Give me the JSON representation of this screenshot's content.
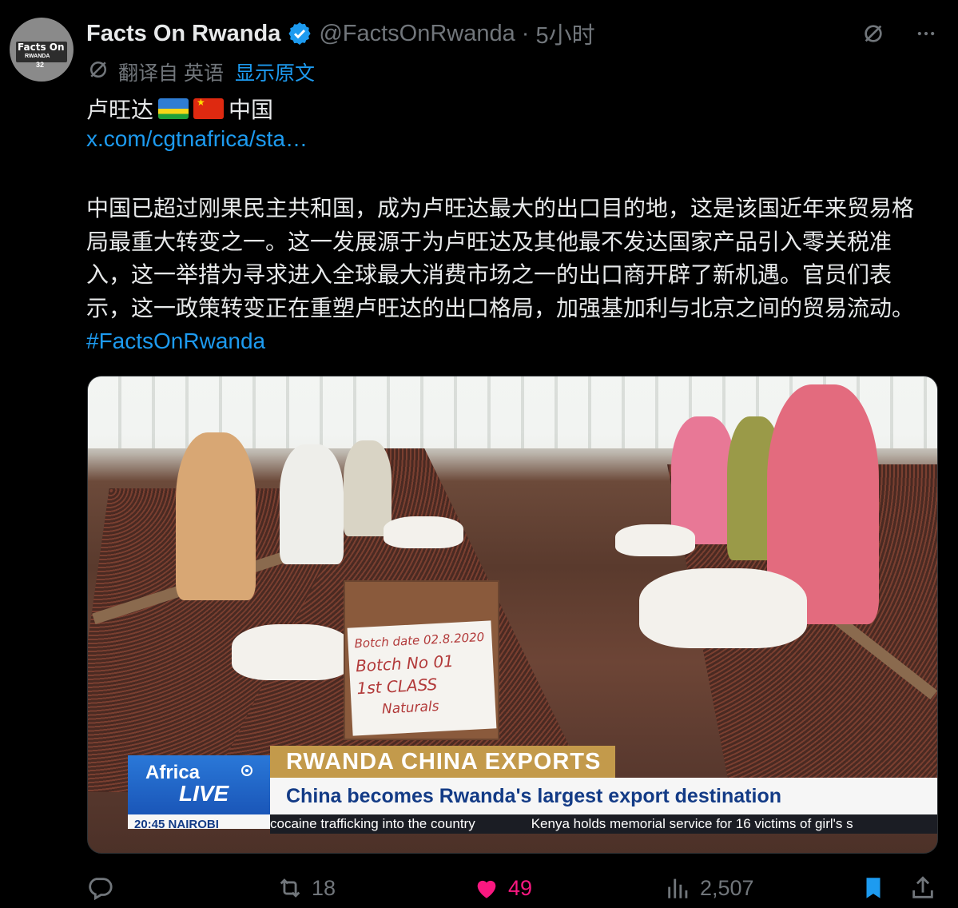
{
  "author": {
    "display_name": "Facts On Rwanda",
    "handle": "@FactsOnRwanda",
    "separator": "·",
    "time": "5小时",
    "avatar_text_top": "Facts On",
    "avatar_text_mid": "RWANDA",
    "avatar_number": "32",
    "verified_icon": "verified-badge-icon"
  },
  "translation": {
    "label": "翻译自 英语",
    "show_original": "显示原文"
  },
  "post": {
    "title_prefix": "卢旺达",
    "title_suffix": "中国",
    "link": "x.com/cgtnafrica/sta…",
    "body": "中国已超过刚果民主共和国，成为卢旺达最大的出口目的地，这是该国近年来贸易格局最重大转变之一。这一发展源于为卢旺达及其他最不发达国家产品引入零关税准入，这一举措为寻求进入全球最大消费市场之一的出口商开辟了新机遇。官员们表示，这一政策转变正在重塑卢旺达的出口格局，加强基加利与北京之间的贸易流动。",
    "hashtag": "#FactsOnRwanda"
  },
  "media": {
    "sign_lines": [
      "Botch date 02.8.2020",
      "Botch No 01",
      "1st CLASS",
      "Naturals"
    ],
    "broadcast_brand": "Africa",
    "broadcast_live": "LIVE",
    "headline": "RWANDA CHINA EXPORTS",
    "subheadline": "China becomes Rwanda's largest export destination",
    "time_city": "20:45 NAIROBI",
    "ticker_1": "cocaine trafficking into the country",
    "ticker_2": "Kenya holds memorial service for 16 victims of girl's s"
  },
  "actions": {
    "reply_count": "",
    "retweet_count": "18",
    "like_count": "49",
    "views_count": "2,507"
  },
  "colors": {
    "accent": "#1d9bf0",
    "like": "#f91880",
    "muted": "#71767b",
    "text": "#e7e9ea",
    "background": "#000000"
  }
}
